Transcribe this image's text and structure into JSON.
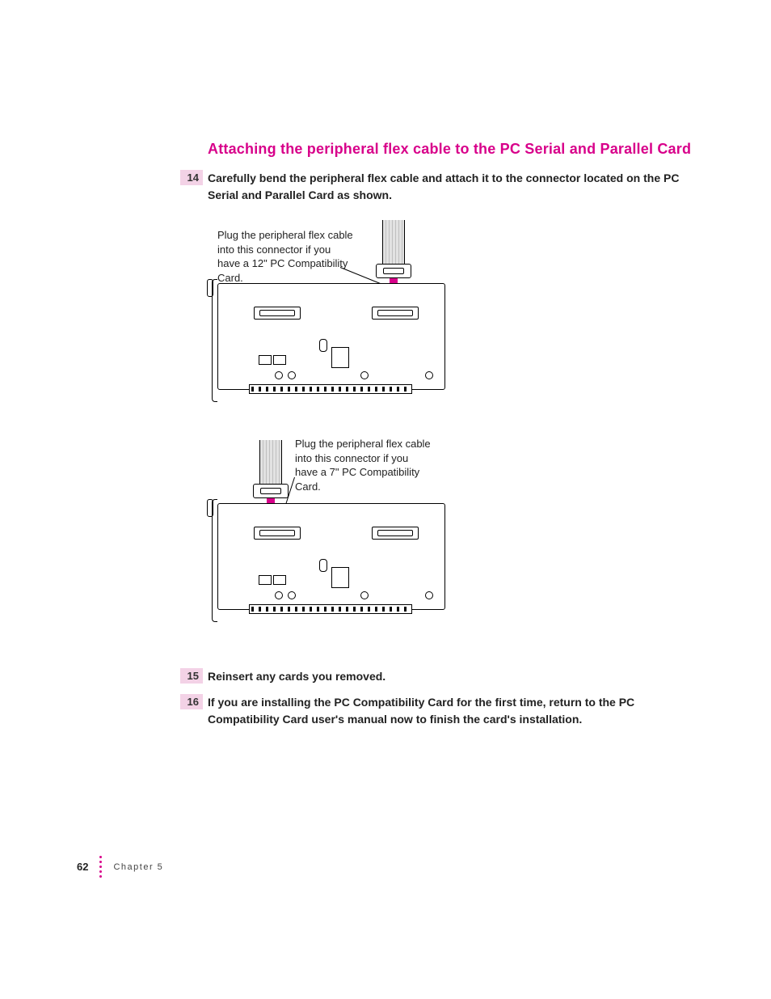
{
  "heading": "Attaching the peripheral flex cable to the PC Serial and Parallel Card",
  "steps": {
    "s14": {
      "num": "14",
      "text": "Carefully bend the peripheral flex cable and attach it to the connector located on the PC Serial and Parallel Card as shown."
    },
    "s15": {
      "num": "15",
      "text": "Reinsert any cards you removed."
    },
    "s16": {
      "num": "16",
      "text": "If you are installing the PC Compatibility Card for the first time, return to the PC Compatibility Card user's manual now to finish the card's installation."
    }
  },
  "callouts": {
    "c1": "Plug the peripheral flex cable into this connector if you have a 12\" PC Compatibility Card.",
    "c2": "Plug the peripheral flex cable into this connector if you have a 7\" PC Compatibility Card."
  },
  "footer": {
    "page": "62",
    "chapter": "Chapter 5"
  }
}
